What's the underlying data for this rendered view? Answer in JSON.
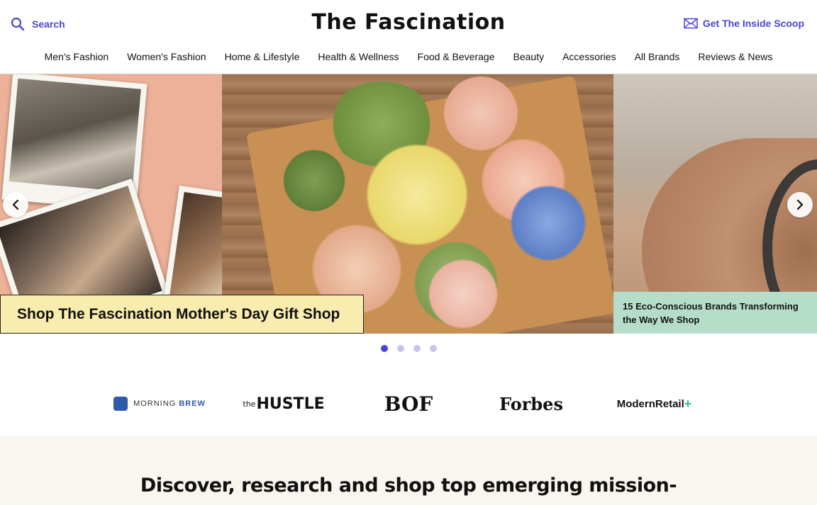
{
  "header": {
    "search_label": "Search",
    "brand": "The Fascination",
    "scoop_label": "Get The Inside Scoop"
  },
  "nav": {
    "items": [
      {
        "label": "Men's Fashion"
      },
      {
        "label": "Women's Fashion"
      },
      {
        "label": "Home & Lifestyle"
      },
      {
        "label": "Health & Wellness"
      },
      {
        "label": "Food & Beverage"
      },
      {
        "label": "Beauty"
      },
      {
        "label": "Accessories"
      },
      {
        "label": "All Brands"
      },
      {
        "label": "Reviews & News"
      }
    ]
  },
  "carousel": {
    "main_caption": "Shop The Fascination Mother's Day Gift Shop",
    "next_caption": "15 Eco-Conscious Brands Transforming the Way We Shop",
    "dots_count": 4,
    "active_dot": 1,
    "icons": {
      "prev": "chevron-left-icon",
      "next": "chevron-right-icon"
    }
  },
  "press": {
    "morning_brew": {
      "prefix": "MORNING ",
      "suffix": "BREW"
    },
    "hustle": {
      "prefix": "the",
      "main": "HUSTLE"
    },
    "bof": "BOF",
    "forbes": "Forbes",
    "modern_retail": {
      "text": "ModernRetail",
      "plus": "+"
    }
  },
  "discover": {
    "heading": "Discover, research and shop top emerging mission-"
  },
  "colors": {
    "accent": "#4a44d6",
    "caption_left_bg": "#f8ecae",
    "caption_right_bg": "#b6ddca",
    "discover_bg": "#f9f6ef"
  }
}
